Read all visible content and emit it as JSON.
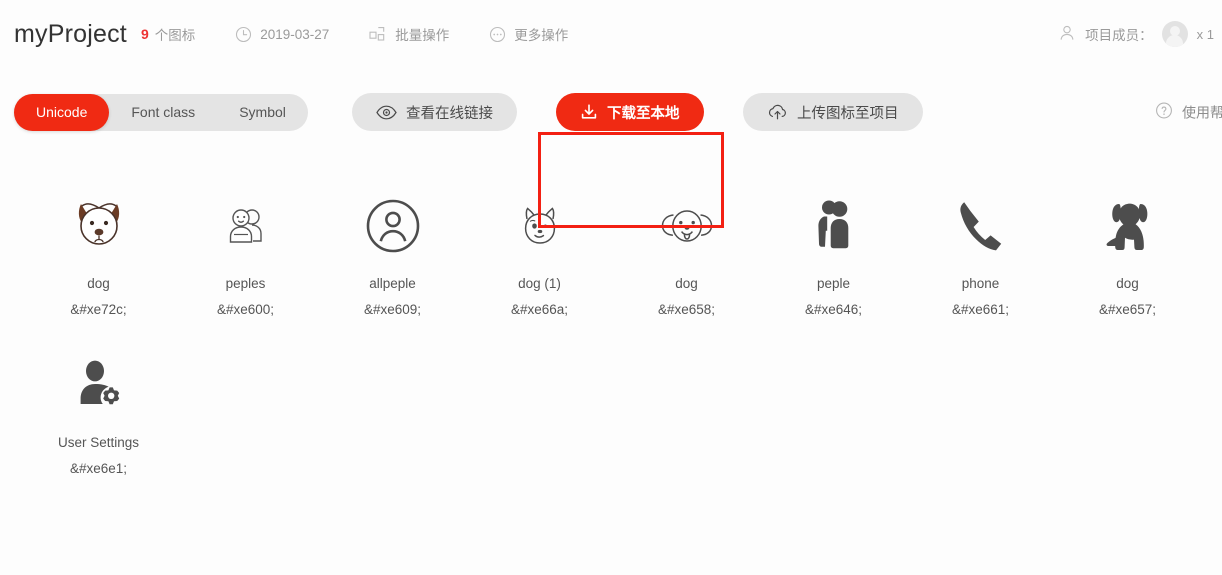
{
  "header": {
    "project_title": "myProject",
    "icon_count": "9",
    "icon_count_label": "个图标",
    "date": "2019-03-27",
    "batch_label": "批量操作",
    "more_label": "更多操作",
    "members_label": "项目成员：",
    "members_count": "x 1",
    "icons": {
      "clock": "clock-icon",
      "grid": "batch-grid-icon",
      "more": "more-ellipsis-icon",
      "members": "members-icon",
      "avatar": "avatar"
    }
  },
  "toolbar": {
    "segments": [
      {
        "label": "Unicode",
        "active": true
      },
      {
        "label": "Font class",
        "active": false
      },
      {
        "label": "Symbol",
        "active": false
      }
    ],
    "online_link_label": "查看在线链接",
    "download_label": "下载至本地",
    "upload_label": "上传图标至项目",
    "help_label": "使用帮",
    "highlight_color": "#f32013",
    "accent_color": "#f02a13",
    "pill_bg": "#e4e4e4"
  },
  "icons": [
    {
      "name": "dog",
      "code": "&#xe72c;",
      "art": "dog-face-brown-ears-icon"
    },
    {
      "name": "peples",
      "code": "&#xe600;",
      "art": "two-people-outline-icon"
    },
    {
      "name": "allpeple",
      "code": "&#xe609;",
      "art": "user-in-circle-icon"
    },
    {
      "name": "dog (1)",
      "code": "&#xe66a;",
      "art": "shiba-face-outline-icon"
    },
    {
      "name": "dog",
      "code": "&#xe658;",
      "art": "dog-tongue-outline-icon"
    },
    {
      "name": "peple",
      "code": "&#xe646;",
      "art": "two-people-solid-icon"
    },
    {
      "name": "phone",
      "code": "&#xe661;",
      "art": "phone-handset-icon"
    },
    {
      "name": "dog",
      "code": "&#xe657;",
      "art": "sitting-dog-solid-icon"
    },
    {
      "name": "User Settings",
      "code": "&#xe6e1;",
      "art": "user-gear-icon"
    }
  ]
}
